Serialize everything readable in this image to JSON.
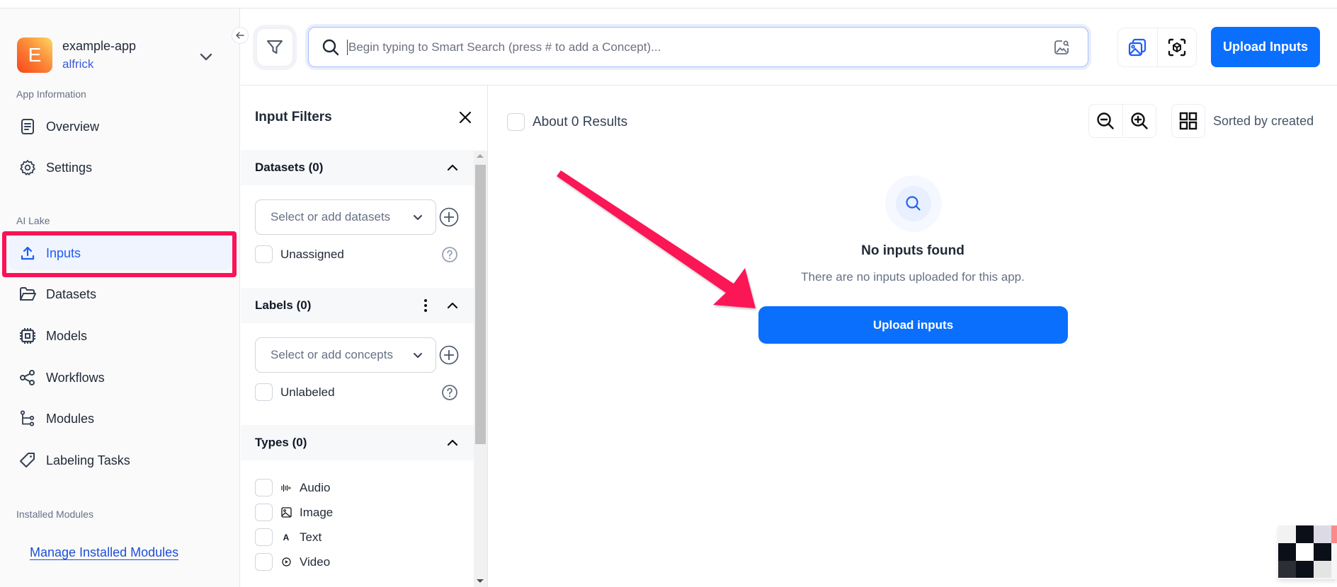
{
  "app": {
    "initial": "E",
    "name": "example-app",
    "user": "alfrick"
  },
  "sidebar": {
    "sections": [
      {
        "label": "App Information"
      },
      {
        "label": "AI Lake"
      },
      {
        "label": "Installed Modules"
      }
    ],
    "items": [
      {
        "label": "Overview",
        "icon": "document-icon"
      },
      {
        "label": "Settings",
        "icon": "gear-icon"
      },
      {
        "label": "Inputs",
        "icon": "upload-icon",
        "active": true
      },
      {
        "label": "Datasets",
        "icon": "folder-open-icon"
      },
      {
        "label": "Models",
        "icon": "cpu-chip-icon"
      },
      {
        "label": "Workflows",
        "icon": "share-nodes-icon"
      },
      {
        "label": "Modules",
        "icon": "module-tree-icon"
      },
      {
        "label": "Labeling Tasks",
        "icon": "tag-icon"
      }
    ],
    "manage_link": "Manage Installed Modules"
  },
  "header": {
    "search_placeholder": "Begin typing to Smart Search (press # to add a Concept)...",
    "search_value": "",
    "upload_label": "Upload Inputs"
  },
  "filters": {
    "title": "Input Filters",
    "datasets": {
      "title": "Datasets (0)",
      "select_placeholder": "Select or add datasets",
      "checkbox_label": "Unassigned"
    },
    "labels": {
      "title": "Labels (0)",
      "select_placeholder": "Select or add concepts",
      "checkbox_label": "Unlabeled"
    },
    "types": {
      "title": "Types (0)",
      "items": [
        {
          "label": "Audio",
          "glyph": "‖"
        },
        {
          "label": "Image",
          "glyph": ""
        },
        {
          "label": "Text",
          "glyph": "A"
        },
        {
          "label": "Video",
          "glyph": ""
        }
      ]
    }
  },
  "main": {
    "results_label": "About 0 Results",
    "sorted_label": "Sorted by created",
    "empty": {
      "title": "No inputs found",
      "subtitle": "There are no inputs uploaded for this app.",
      "button": "Upload inputs"
    }
  },
  "colors": {
    "primary": "#0b6ffd",
    "annotation": "#fb1257",
    "active_bg": "#eff4ff",
    "active_text": "#1d5cf5"
  }
}
